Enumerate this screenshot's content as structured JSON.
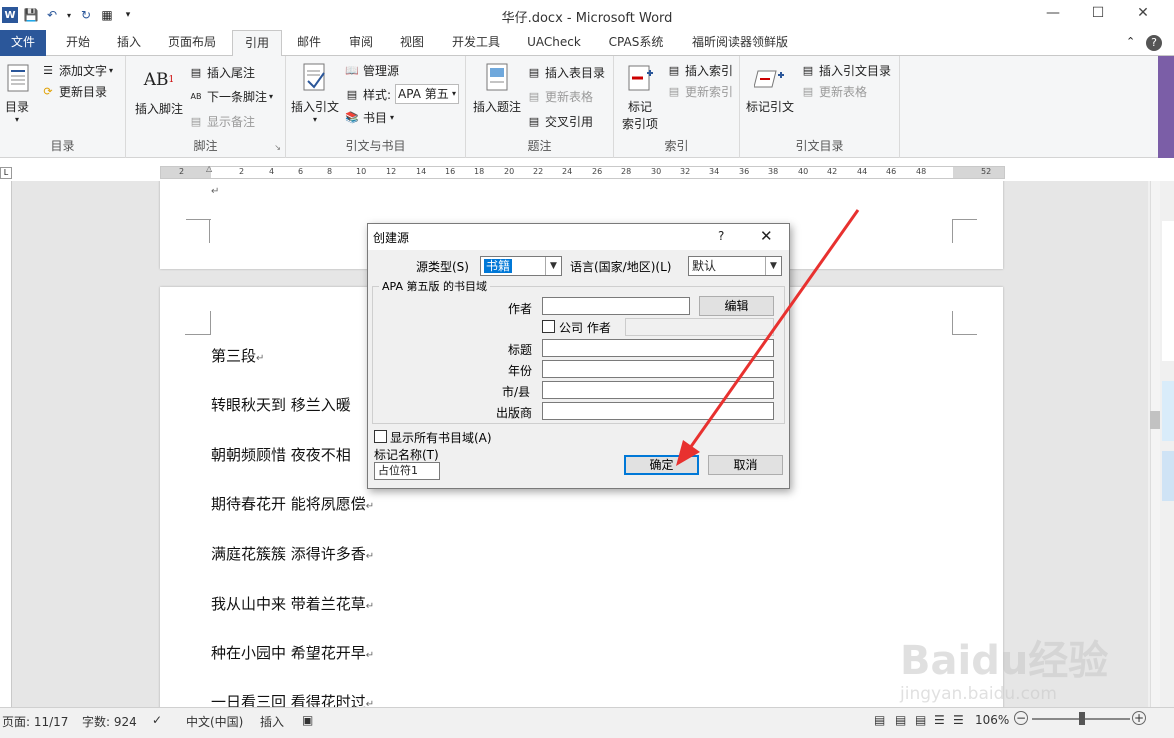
{
  "window": {
    "title": "华仔.docx - Microsoft Word",
    "minimize_icon": "minimize-icon",
    "maximize_icon": "maximize-icon",
    "close_icon": "close-icon",
    "help_icon": "help-icon"
  },
  "tabs": [
    "文件",
    "开始",
    "插入",
    "页面布局",
    "引用",
    "邮件",
    "审阅",
    "视图",
    "开发工具",
    "UACheck",
    "CPAS系统",
    "福昕阅读器领鲜版"
  ],
  "ribbon": {
    "toc": {
      "big": "目录",
      "add_text": "添加文字",
      "update_table": "更新目录",
      "label": "目录"
    },
    "footnotes": {
      "big": "插入脚注",
      "insert_endnote": "插入尾注",
      "next_footnote": "下一条脚注",
      "show_notes": "显示备注",
      "label": "脚注"
    },
    "citations": {
      "big": "插入引文",
      "manage_sources": "管理源",
      "style_label": "样式:",
      "style_value": "APA 第五",
      "bibliography": "书目",
      "label": "引文与书目"
    },
    "captions": {
      "big": "插入题注",
      "insert_tof": "插入表目录",
      "update_table": "更新表格",
      "cross_ref": "交叉引用",
      "label": "题注"
    },
    "index": {
      "big_line1": "标记",
      "big_line2": "索引项",
      "insert_index": "插入索引",
      "update_index": "更新索引",
      "label": "索引"
    },
    "toa": {
      "big": "标记引文",
      "insert_toa": "插入引文目录",
      "update_table": "更新表格",
      "label": "引文目录"
    }
  },
  "ruler": [
    "2",
    "2",
    "4",
    "6",
    "8",
    "10",
    "12",
    "14",
    "16",
    "18",
    "20",
    "22",
    "24",
    "26",
    "28",
    "30",
    "32",
    "34",
    "36",
    "38",
    "40",
    "42",
    "44",
    "46",
    "48",
    "52"
  ],
  "document": {
    "paragraphs": [
      "第三段",
      "转眼秋天到 移兰入暖",
      "朝朝频顾惜 夜夜不相",
      "期待春花开 能将夙愿偿",
      "满庭花簇簇 添得许多香",
      "我从山中来 带着兰花草",
      "种在小园中 希望花开早",
      "一日看三回 看得花时过"
    ]
  },
  "dialog": {
    "title": "创建源",
    "help": "?",
    "source_type_label": "源类型(S)",
    "source_type_value": "书籍",
    "language_label": "语言(国家/地区)(L)",
    "language_value": "默认",
    "group_title": "APA 第五版 的书目域",
    "author_label": "作者",
    "edit_button": "编辑",
    "corporate_label": "公司 作者",
    "title_label": "标题",
    "year_label": "年份",
    "city_label": "市/县",
    "publisher_label": "出版商",
    "show_all_label": "显示所有书目域(A)",
    "tag_name_label": "标记名称(T)",
    "tag_name_value": "占位符1",
    "ok_button": "确定",
    "cancel_button": "取消"
  },
  "statusbar": {
    "page": "页面: 11/17",
    "words": "字数: 924",
    "language": "中文(中国)",
    "mode": "插入",
    "zoom": "106%"
  },
  "watermark": {
    "brand": "Baidu经验",
    "url": "jingyan.baidu.com"
  },
  "colors": {
    "file_tab": "#2b579a",
    "arrow": "#e8312f",
    "dialog_default": "#0078d7"
  }
}
